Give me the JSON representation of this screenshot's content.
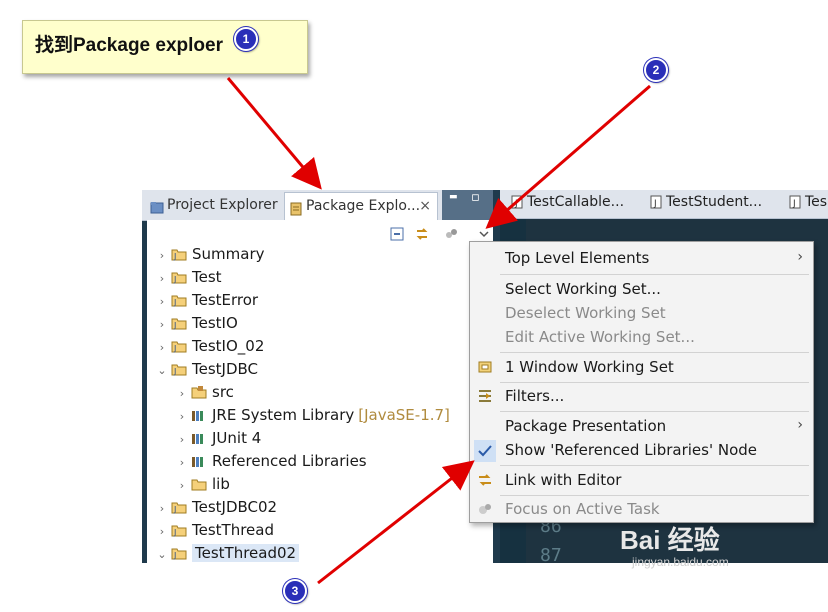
{
  "callout": {
    "text": "找到Package exploer",
    "badges": [
      "1",
      "2",
      "3"
    ]
  },
  "tabs": {
    "project_explorer": "Project Explorer",
    "package_explorer": "Package Explo...",
    "close": "×",
    "minimize": "▬",
    "maximize": "▫"
  },
  "tree": [
    {
      "label": "Summary",
      "expanded": false
    },
    {
      "label": "Test",
      "expanded": false
    },
    {
      "label": "TestError",
      "expanded": false
    },
    {
      "label": "TestIO",
      "expanded": false
    },
    {
      "label": "TestIO_02",
      "expanded": false
    },
    {
      "label": "TestJDBC",
      "expanded": true
    },
    {
      "label": "src",
      "child": true
    },
    {
      "label": "JRE System Library",
      "child": true,
      "decoration": "[JavaSE-1.7]"
    },
    {
      "label": "JUnit 4",
      "child": true
    },
    {
      "label": "Referenced Libraries",
      "child": true
    },
    {
      "label": "lib",
      "child": true
    },
    {
      "label": "TestJDBC02",
      "expanded": false
    },
    {
      "label": "TestThread",
      "expanded": false
    },
    {
      "label": "TestThread02",
      "expanded": true,
      "selected": true
    }
  ],
  "editor": {
    "tabs": [
      "TestCallable...",
      "TestStudent...",
      "Tes"
    ],
    "line_numbers": [
      "86",
      "87"
    ]
  },
  "menu": {
    "top_level_elements": "Top Level Elements",
    "select_working_set": "Select Working Set...",
    "deselect_working_set": "Deselect Working Set",
    "edit_active_working_set": "Edit Active Working Set...",
    "window_working_set": "1 Window Working Set",
    "filters": "Filters...",
    "package_presentation": "Package Presentation",
    "show_referenced_libraries": "Show 'Referenced Libraries' Node",
    "link_with_editor": "Link with Editor",
    "focus_on_active_task": "Focus on Active Task",
    "submenu_arrow": "›"
  },
  "watermark": {
    "brand": "Bai 经验",
    "url": "jingyan.baidu.com"
  },
  "colors": {
    "arrow": "#e00000",
    "badge": "#2a2fb8",
    "note_bg": "#ffffcc",
    "selection": "#dbe7f6"
  }
}
